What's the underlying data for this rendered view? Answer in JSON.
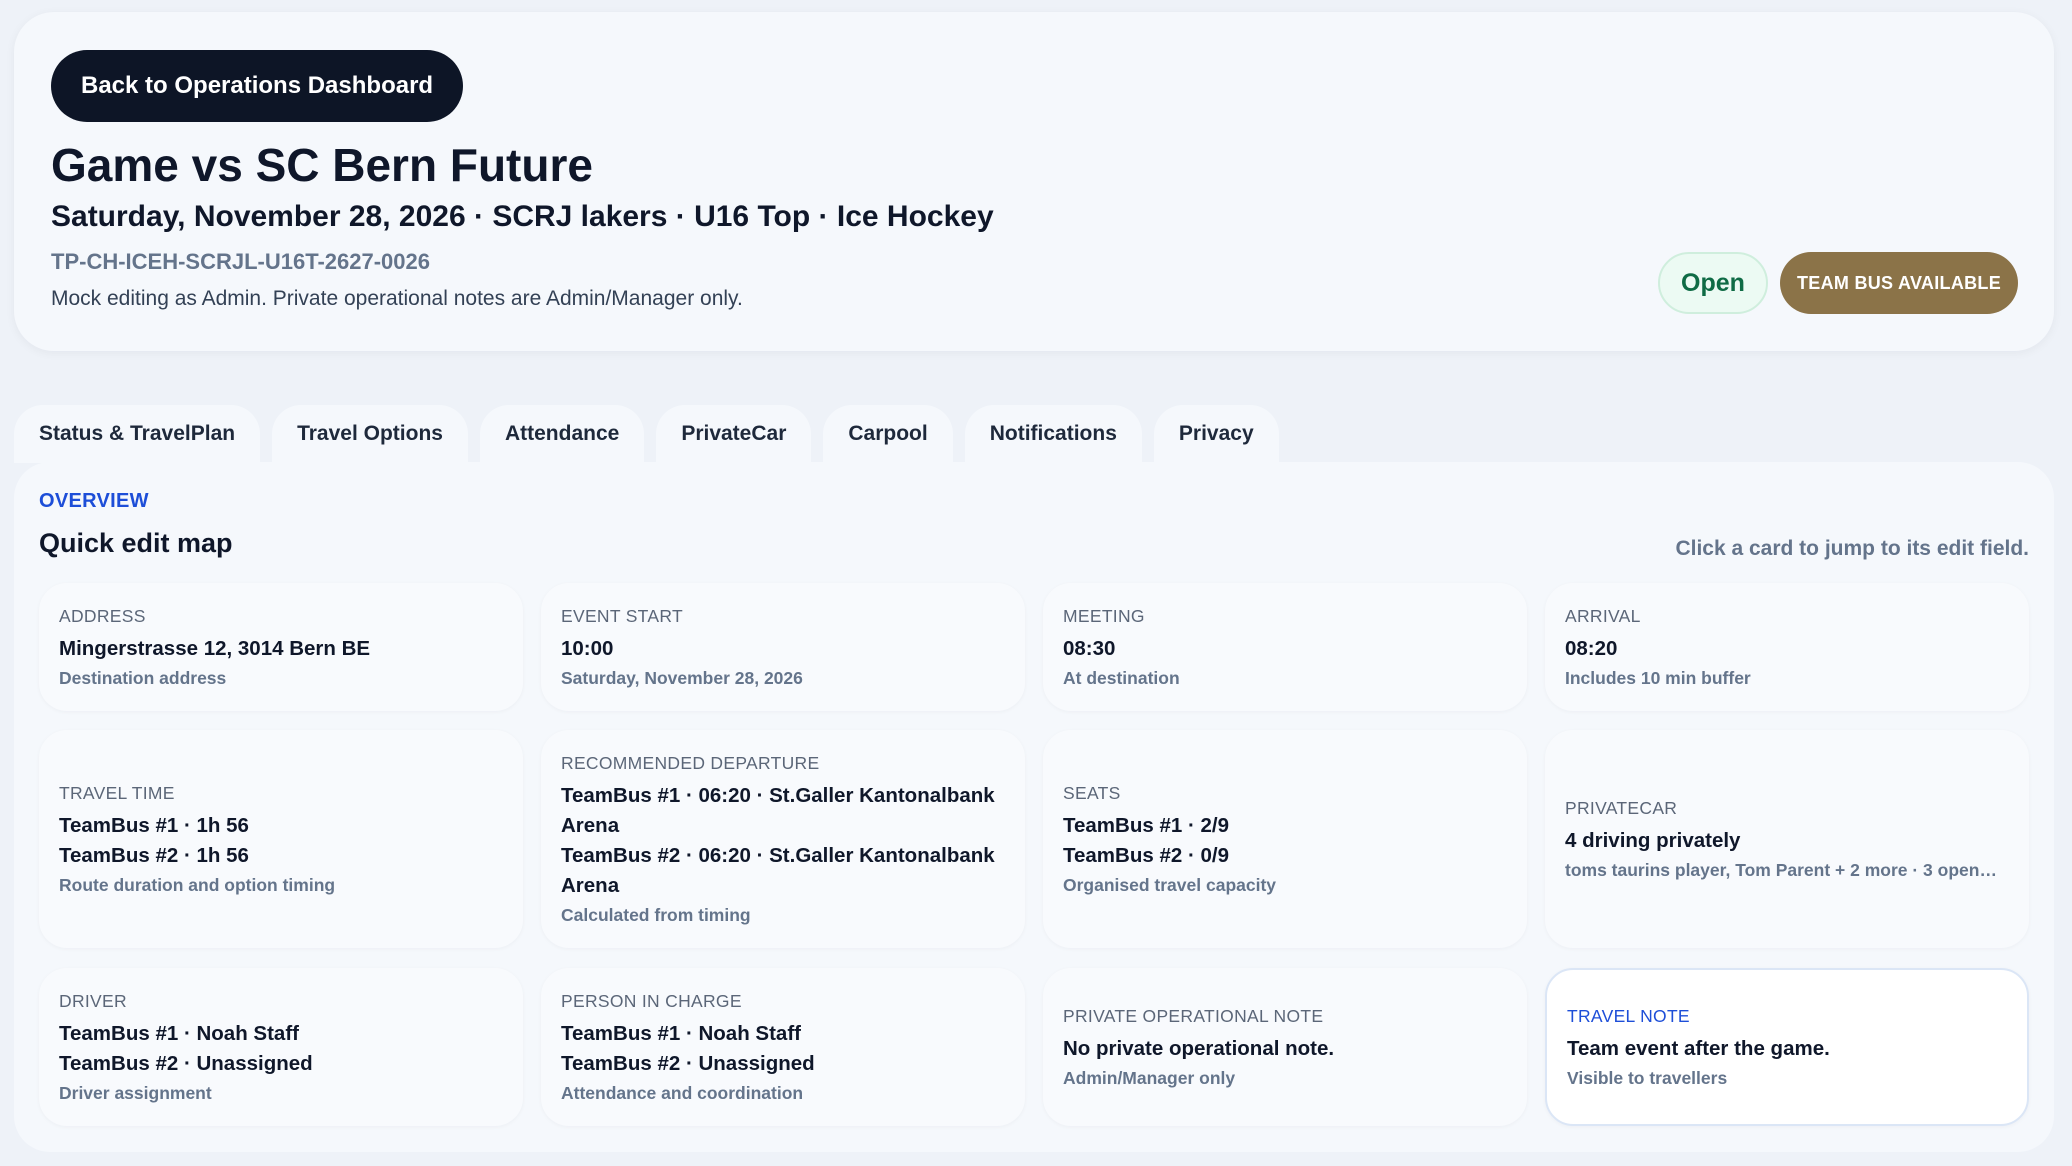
{
  "header": {
    "back_label": "Back to Operations Dashboard",
    "title": "Game vs SC Bern Future",
    "subtitle": "Saturday, November 28, 2026 · SCRJ lakers · U16 Top · Ice Hockey",
    "code": "TP-CH-ICEH-SCRJL-U16T-2627-0026",
    "note": "Mock editing as Admin. Private operational notes are Admin/Manager only.",
    "status": "Open",
    "badge": "TEAM BUS AVAILABLE"
  },
  "tabs": [
    "Status & TravelPlan",
    "Travel Options",
    "Attendance",
    "PrivateCar",
    "Carpool",
    "Notifications",
    "Privacy"
  ],
  "overview": {
    "label": "OVERVIEW",
    "title": "Quick edit map",
    "hint": "Click a card to jump to its edit field."
  },
  "cards": {
    "address": {
      "label": "ADDRESS",
      "lines": [
        "Mingerstrasse 12, 3014 Bern BE"
      ],
      "sub": "Destination address"
    },
    "event_start": {
      "label": "EVENT START",
      "lines": [
        "10:00"
      ],
      "sub": "Saturday, November 28, 2026"
    },
    "meeting": {
      "label": "MEETING",
      "lines": [
        "08:30"
      ],
      "sub": "At destination"
    },
    "arrival": {
      "label": "ARRIVAL",
      "lines": [
        "08:20"
      ],
      "sub": "Includes 10 min buffer"
    },
    "travel_time": {
      "label": "TRAVEL TIME",
      "lines": [
        "TeamBus #1 · 1h 56",
        "TeamBus #2 · 1h 56"
      ],
      "sub": "Route duration and option timing"
    },
    "departure": {
      "label": "RECOMMENDED DEPARTURE",
      "lines": [
        "TeamBus #1 · 06:20 · St.Galler Kantonalbank Arena",
        "TeamBus #2 · 06:20 · St.Galler Kantonalbank Arena"
      ],
      "sub": "Calculated from timing"
    },
    "seats": {
      "label": "SEATS",
      "lines": [
        "TeamBus #1 · 2/9",
        "TeamBus #2 · 0/9"
      ],
      "sub": "Organised travel capacity"
    },
    "privatecar": {
      "label": "PRIVATECAR",
      "lines": [
        "4 driving privately"
      ],
      "sub": "toms taurins player, Tom Parent + 2 more · 3 open…"
    },
    "driver": {
      "label": "DRIVER",
      "lines": [
        "TeamBus #1 · Noah Staff",
        "TeamBus #2 · Unassigned"
      ],
      "sub": "Driver assignment"
    },
    "person_in_charge": {
      "label": "PERSON IN CHARGE",
      "lines": [
        "TeamBus #1 · Noah Staff",
        "TeamBus #2 · Unassigned"
      ],
      "sub": "Attendance and coordination"
    },
    "private_note": {
      "label": "PRIVATE OPERATIONAL NOTE",
      "lines": [
        "No private operational note."
      ],
      "sub": "Admin/Manager only"
    },
    "travel_note": {
      "label": "TRAVEL NOTE",
      "lines": [
        "Team event after the game."
      ],
      "sub": "Visible to travellers"
    }
  }
}
